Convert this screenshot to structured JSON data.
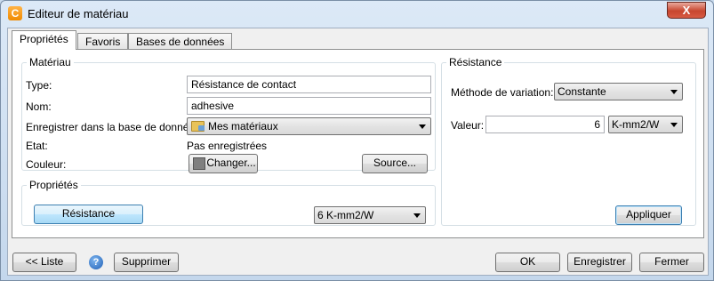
{
  "window": {
    "title": "Editeur de matériau",
    "app_icon": "C",
    "close_glyph": "X"
  },
  "tabs": [
    "Propriétés",
    "Favoris",
    "Bases de données"
  ],
  "materiau": {
    "legend": "Matériau",
    "type_label": "Type:",
    "type_value": "Résistance de contact",
    "nom_label": "Nom:",
    "nom_value": "adhesive",
    "db_label": "Enregistrer dans la base de données:",
    "db_value": "Mes matériaux",
    "etat_label": "Etat:",
    "etat_value": "Pas enregistrées",
    "couleur_label": "Couleur:",
    "changer_label": "Changer...",
    "source_label": "Source...",
    "swatch_color": "#7f7f7f"
  },
  "proprietes": {
    "legend": "Propriétés",
    "resistance_button": "Résistance",
    "value_select": "6 K-mm2/W"
  },
  "resistance": {
    "legend": "Résistance",
    "methode_label": "Méthode de variation:",
    "methode_value": "Constante",
    "valeur_label": "Valeur:",
    "valeur_value": "6",
    "unit_value": "K-mm2/W",
    "appliquer_label": "Appliquer"
  },
  "footer": {
    "liste_label": "<< Liste",
    "supprimer_label": "Supprimer",
    "ok_label": "OK",
    "enregistrer_label": "Enregistrer",
    "fermer_label": "Fermer"
  }
}
